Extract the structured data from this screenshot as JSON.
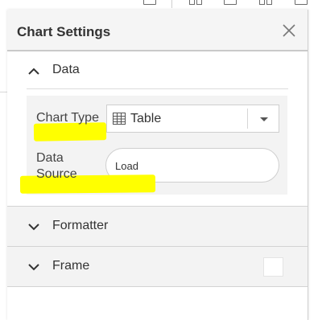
{
  "panel": {
    "title": "Chart Settings"
  },
  "sections": {
    "data": {
      "label": "Data",
      "expanded": true,
      "chart_type_label": "Chart Type",
      "chart_type_value": "Table",
      "chart_type_icon": "table-icon",
      "data_source_label_line1": "Data",
      "data_source_label_line2": "Source",
      "data_source_value": "Load"
    },
    "formatter": {
      "label": "Formatter",
      "expanded": false
    },
    "frame": {
      "label": "Frame",
      "expanded": false
    }
  },
  "colors": {
    "highlight": "#ffff00",
    "header_bg": "#f5f5f5",
    "section_bg": "#f3f3f3"
  }
}
